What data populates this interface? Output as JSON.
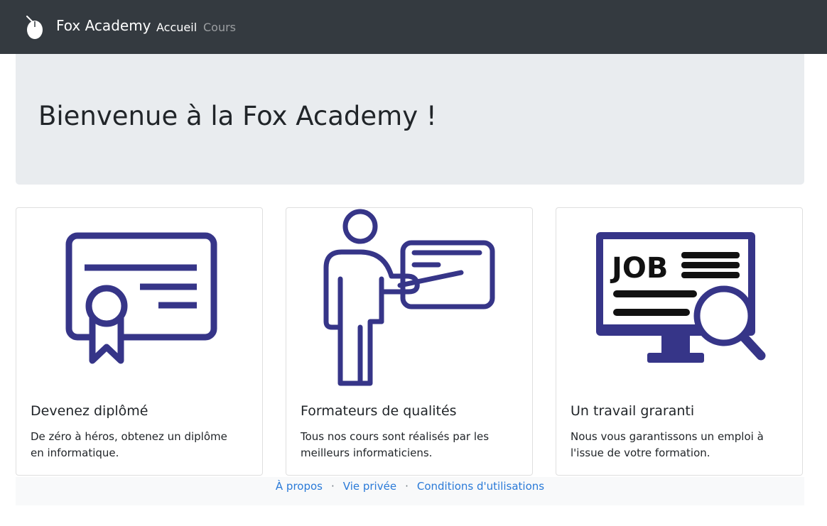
{
  "navbar": {
    "brand": "Fox Academy",
    "links": [
      {
        "label": "Accueil",
        "active": true
      },
      {
        "label": "Cours",
        "active": false
      }
    ]
  },
  "jumbotron": {
    "title": "Bienvenue à la Fox Academy !"
  },
  "cards": [
    {
      "icon": "diploma-icon",
      "title": "Devenez diplômé",
      "text": "De zéro à héros, obtenez un diplôme en informatique."
    },
    {
      "icon": "trainer-icon",
      "title": "Formateurs de qualités",
      "text": "Tous nos cours sont réalisés par les meilleurs informaticiens."
    },
    {
      "icon": "job-search-icon",
      "job_word": "JOB",
      "title": "Un travail graranti",
      "text": "Nous vous garantissons un emploi à l'issue de votre formation."
    }
  ],
  "footer": {
    "links": [
      "À propos",
      "Vie privée",
      "Conditions d'utilisations"
    ],
    "separator": "·"
  },
  "colors": {
    "navbar": "#343a40",
    "jumbotron": "#e9ecef",
    "icon": "#363588",
    "link": "#2a7ad8"
  }
}
